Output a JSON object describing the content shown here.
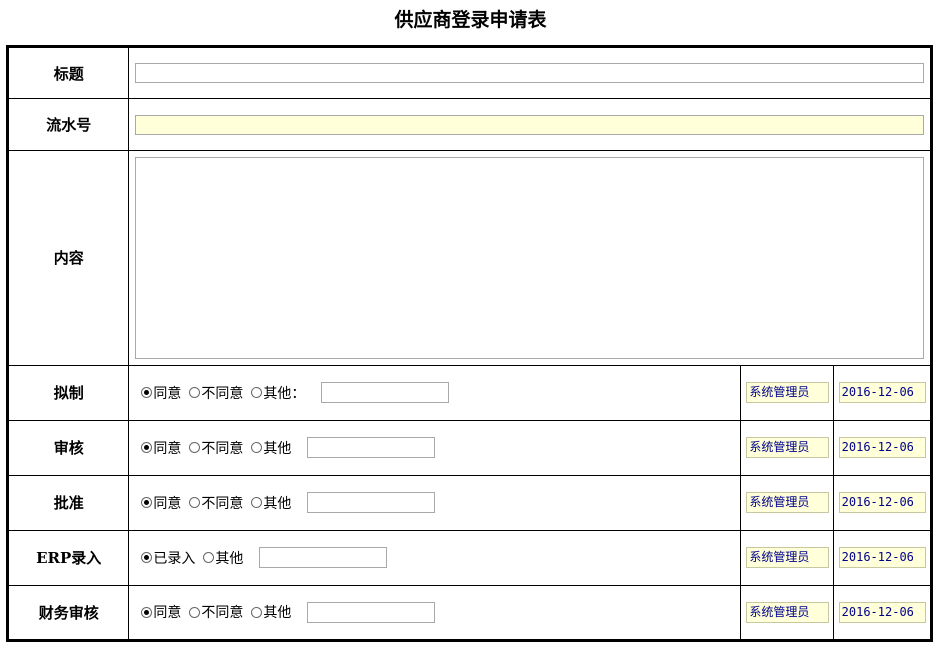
{
  "page_title": "供应商登录申请表",
  "fields": {
    "title_label": "标题",
    "serial_label": "流水号",
    "content_label": "内容"
  },
  "rows": [
    {
      "label": "拟制",
      "options": [
        "同意",
        "不同意",
        "其他："
      ],
      "signer": "系统管理员",
      "date": "2016-12-06"
    },
    {
      "label": "审核",
      "options": [
        "同意",
        "不同意",
        "其他"
      ],
      "signer": "系统管理员",
      "date": "2016-12-06"
    },
    {
      "label": "批准",
      "options": [
        "同意",
        "不同意",
        "其他"
      ],
      "signer": "系统管理员",
      "date": "2016-12-06"
    },
    {
      "label": "ERP录入",
      "options": [
        "已录入",
        "其他"
      ],
      "signer": "系统管理员",
      "date": "2016-12-06"
    },
    {
      "label": "财务审核",
      "options": [
        "同意",
        "不同意",
        "其他"
      ],
      "signer": "系统管理员",
      "date": "2016-12-06"
    }
  ]
}
